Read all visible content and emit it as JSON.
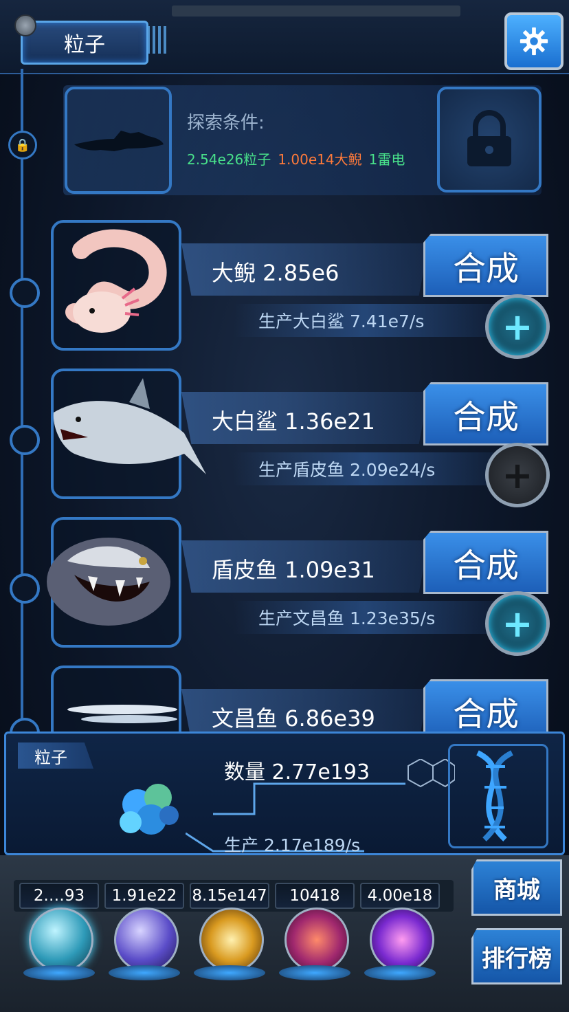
{
  "header": {
    "title": "粒子",
    "settings_icon": "gear-icon"
  },
  "explore": {
    "label": "探索条件:",
    "req_particles": "2.54e26粒子",
    "req_axolotl": "1.00e14大鲵",
    "req_thunder": "1雷电",
    "lock_icon": "lock-icon"
  },
  "creatures": [
    {
      "name": "大鲵 2.85e6",
      "combine": "合成",
      "production": "生产大白鲨 7.41e7/s",
      "plus_active": true
    },
    {
      "name": "大白鲨 1.36e21",
      "combine": "合成",
      "production": "生产盾皮鱼 2.09e24/s",
      "plus_active": false
    },
    {
      "name": "盾皮鱼 1.09e31",
      "combine": "合成",
      "production": "生产文昌鱼 1.23e35/s",
      "plus_active": true
    },
    {
      "name": "文昌鱼 6.86e39",
      "combine": "合成"
    }
  ],
  "particle_panel": {
    "tab": "粒子",
    "count": "数量 2.77e193",
    "production": "生产 2.17e189/s"
  },
  "resources": [
    "2.…93",
    "1.91e22",
    "8.15e147",
    "10418",
    "4.00e18"
  ],
  "side_buttons": {
    "shop": "商城",
    "leaderboard": "排行榜"
  },
  "colors": {
    "accent": "#3478c4",
    "req_green": "#48e08a",
    "req_orange": "#ff7a3a"
  }
}
